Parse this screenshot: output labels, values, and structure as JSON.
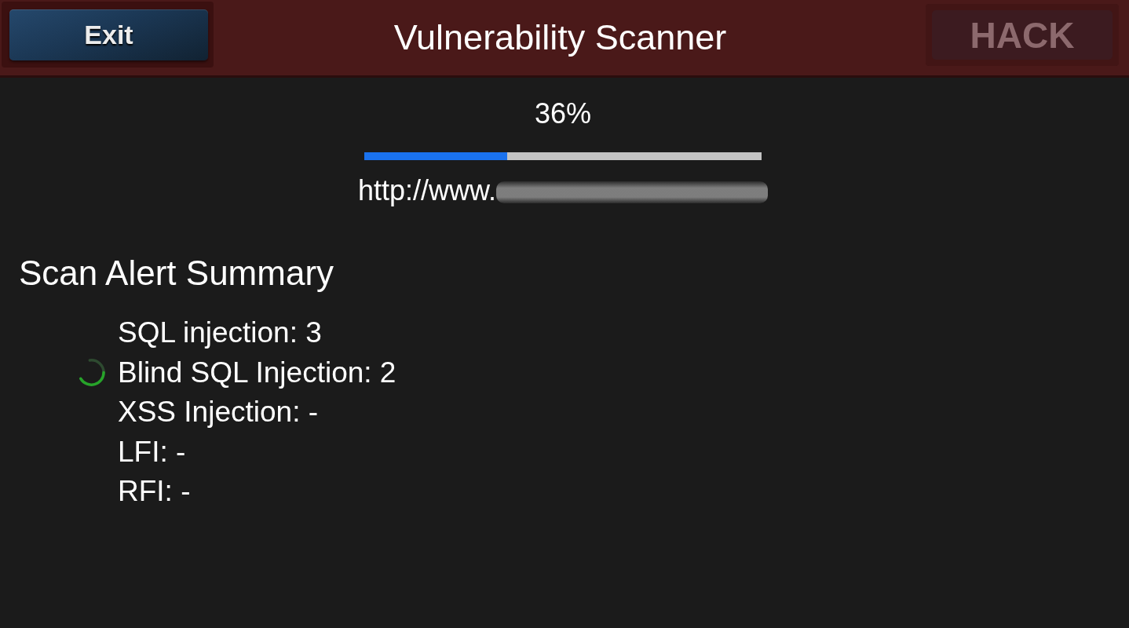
{
  "header": {
    "exit_button": {
      "label": "Exit",
      "disabled": false
    },
    "title": "Vulnerability Scanner",
    "hack_button": {
      "label": "HACK",
      "disabled": true
    }
  },
  "progress": {
    "reading": "36%",
    "level": 0.36
  },
  "target": {
    "url": "http://www.",
    "blurred": true
  },
  "summary": {
    "title": "Scan Alert Summary",
    "alerts": [
      {
        "label": "SQL injection: 3",
        "scanning": false
      },
      {
        "label": "Blind SQL Injection: 2",
        "scanning": true
      },
      {
        "label": "XSS Injection: -",
        "scanning": false
      },
      {
        "label": "LFI: -",
        "scanning": false
      },
      {
        "label": "RFI: -",
        "scanning": false
      }
    ]
  }
}
